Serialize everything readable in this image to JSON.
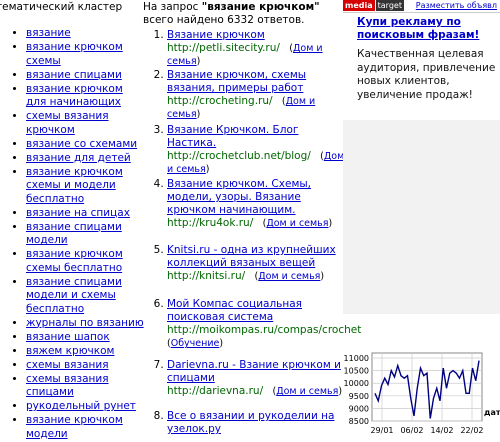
{
  "cluster": {
    "heading": "тематический кластер",
    "items": [
      "вязание",
      "вязание крючком схемы",
      "вязание спицами",
      "вязание крючком для начинающих",
      "схемы вязания крючком",
      "вязание со схемами",
      "вязание для детей",
      "вязание крючком схемы и модели бесплатно",
      "вязание на спицах",
      "вязание спицами модели",
      "вязание крючком схемы бесплатно",
      "вязание спицами модели и схемы бесплатно",
      "журналы по вязанию",
      "вязание шапок",
      "вяжем крючком",
      "схемы вязания",
      "схемы вязания спицами",
      "рукодельный рунет",
      "вязание крючком модели"
    ]
  },
  "query": {
    "prefix": "На запрос ",
    "term": "\"вязание крючком\"",
    "suffix": " всего найдено 6332 ответов."
  },
  "results": [
    {
      "num": "1.",
      "title": "Вязание крючком",
      "url": "http://petli.sitecity.ru/",
      "extra": "Дом и семья"
    },
    {
      "num": "2.",
      "title": "Вязание крючком, схемы вязания, примеры работ",
      "url": "http://crocheting.ru/",
      "extra": "Дом и семья"
    },
    {
      "num": "3.",
      "title": "Вязание Крючком. Блог Настика.",
      "url": "http://crochetclub.net/blog/",
      "extra": "Дом и семья"
    },
    {
      "num": "4.",
      "title": "Вязание крючком. Схемы, модели, узоры. Вязание крючком начинающим.",
      "url": "http://kru4ok.ru/",
      "extra": "Дом и семья"
    },
    {
      "num": "5.",
      "title": "Knitsi.ru - одна из крупнейших коллекций вязаных вещей",
      "url": "http://knitsi.ru/",
      "extra": "Дом и семья"
    },
    {
      "num": "6.",
      "title": "Мой Компас социальная поисковая система",
      "url": "http://moikompas.ru/compas/crochet",
      "extra": "Обучение"
    },
    {
      "num": "7.",
      "title": "Darievna.ru - Взание крючком и спицами",
      "url": "http://darievna.ru/",
      "extra": "Дом и семья"
    },
    {
      "num": "8.",
      "title": "Все о вязании и рукоделии на узелок.ру",
      "url": "",
      "extra": ""
    }
  ],
  "ad": {
    "logo_media": "media",
    "logo_target": "target",
    "place_link": "Разместить объявл",
    "title": "Купи рекламу по поисковым фразам!",
    "body": "Качественная целевая аудитория, привлечение новых клиентов, увеличение продаж!"
  },
  "chart_data": {
    "type": "line",
    "y_ticks": [
      "11000",
      "10500",
      "10000",
      "9500",
      "9000",
      "8500"
    ],
    "x_ticks": [
      "29/01",
      "06/02",
      "14/02",
      "22/02"
    ],
    "x_axis_label": "дат",
    "ylim": [
      8500,
      11200
    ],
    "series": [
      {
        "values": [
          9600,
          9300,
          9900,
          10200,
          9950,
          10500,
          10250,
          10700,
          10300,
          10200,
          10300,
          9400,
          8700,
          9800,
          10600,
          10300,
          10400,
          8600,
          9400,
          9800,
          9300,
          10600,
          9800,
          10400,
          10500,
          10400,
          10200,
          10500,
          9600,
          9600,
          10600,
          10100,
          10900
        ]
      }
    ],
    "line_color": "#000080"
  }
}
